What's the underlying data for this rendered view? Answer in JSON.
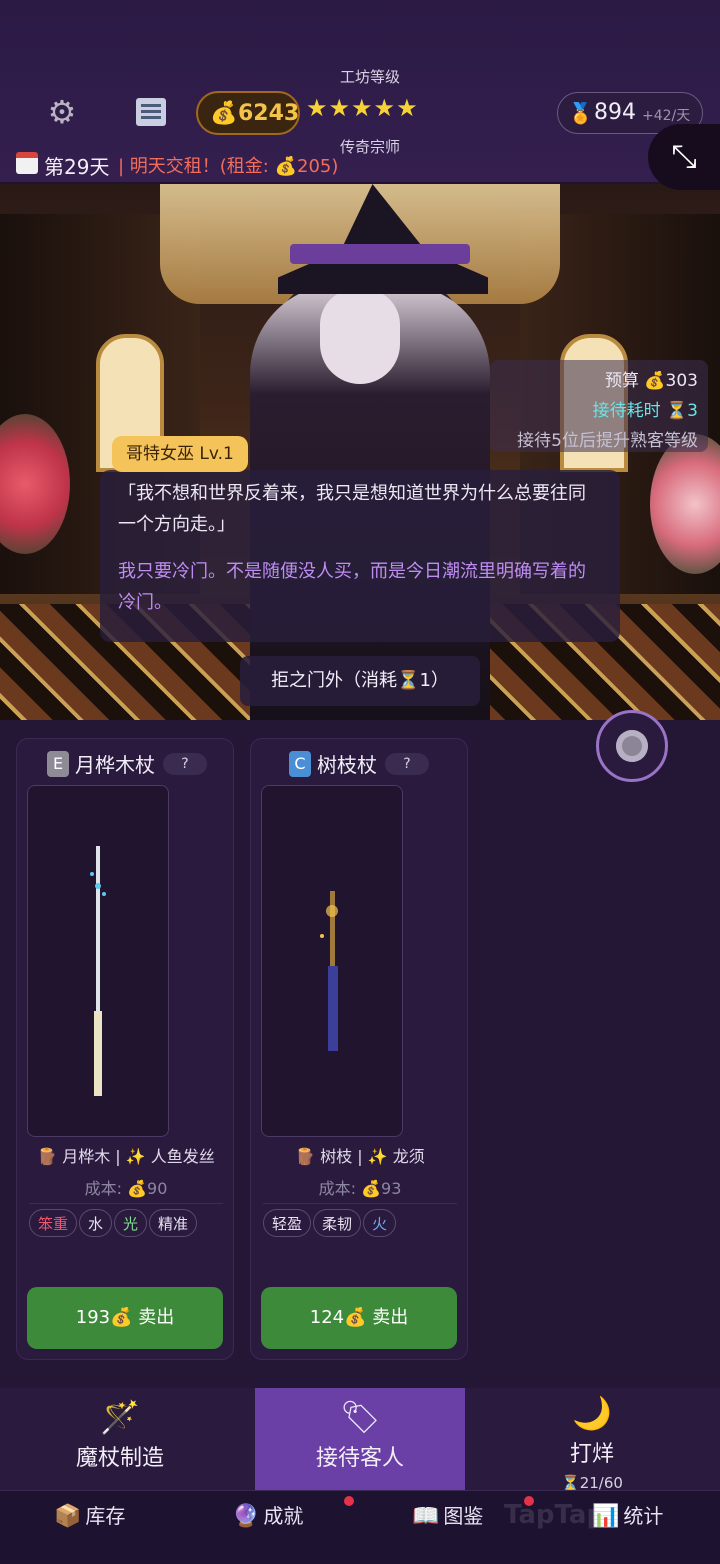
{
  "header": {
    "gold": "6243",
    "workshop_level_label": "工坊等级",
    "stars": "★★★★★",
    "rank_title": "传奇宗师",
    "medals": "894",
    "medals_rate": "+42/天",
    "day": "第29天",
    "rent_notice": "| 明天交租！(租金: 💰205)"
  },
  "scene": {
    "budget": "预算 💰303",
    "wait_cost": "接待耗时 ⏳3",
    "promotion_hint": "接待5位后提升熟客等级",
    "customer_name": "哥特女巫 Lv.1",
    "quote": "「我不想和世界反着来，我只是想知道世界为什么总要往同一个方向走。」",
    "request": "我只要冷门。不是随便没人买，而是今日潮流里明确写着的冷门。",
    "reject_button": "拒之门外（消耗⏳1）"
  },
  "cards": [
    {
      "grade": "E",
      "grade_color": "#8e8a96",
      "name": "月桦木杖",
      "help": "?",
      "materials": "🪵 月桦木 | ✨ 人鱼发丝",
      "cost": "成本: 💰90",
      "tags": [
        {
          "text": "笨重",
          "color": "#f0556b"
        },
        {
          "text": "水",
          "color": "#e8e2f2"
        },
        {
          "text": "光",
          "color": "#7de08a"
        },
        {
          "text": "精准",
          "color": "#e8e2f2"
        }
      ],
      "sell": "193💰 卖出"
    },
    {
      "grade": "C",
      "grade_color": "#4a8fd6",
      "name": "树枝杖",
      "help": "?",
      "materials": "🪵 树枝 | ✨ 龙须",
      "cost": "成本: 💰93",
      "tags": [
        {
          "text": "轻盈",
          "color": "#e8e2f2"
        },
        {
          "text": "柔韧",
          "color": "#e8e2f2"
        },
        {
          "text": "火",
          "color": "#6fa8f0"
        }
      ],
      "sell": "124💰 卖出"
    }
  ],
  "nav": {
    "craft": "魔杖制造",
    "serve": "接待客人",
    "close_shop": "打烊",
    "energy": "⏳21/60"
  },
  "subnav": {
    "inventory": "库存",
    "achievements": "成就",
    "codex": "图鉴",
    "stats": "统计",
    "watermark": "TapTap"
  }
}
